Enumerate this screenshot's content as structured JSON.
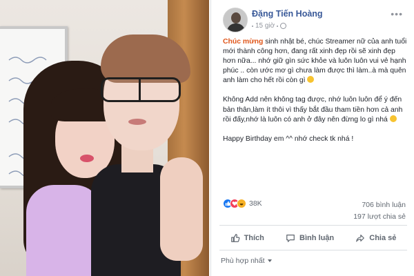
{
  "post": {
    "author": "Đặng Tiến Hoàng",
    "time": "15 giờ",
    "paragraph1_highlight": "Chúc mừng",
    "paragraph1_rest": " sinh nhật bé, chúc Streamer nữ của anh tuổi mới thành công hơn, đang rất xinh đẹp rồi sẽ xinh đẹp hơn nữa... nhớ giữ gìn sức khỏe và luôn luôn vui vẻ hạnh phúc .. còn ước mơ gì chưa làm được thì làm..à mà quên anh làm cho hết rồi còn gì",
    "paragraph2": "Không Add nên không tag được, nhớ luôn luôn để ý đến bản thân,làm ít thôi vì thấy bắt đầu tham tiền hơn cả anh rồi đấy,nhớ là luôn có anh ở đây nên đừng lo gì nhá",
    "paragraph3": "Happy Birthday em ^^ nhớ check tk nhá !",
    "reaction_count": "38K",
    "comments": "706 bình luận",
    "shares": "197 lượt chia sẻ",
    "actions": {
      "like": "Thích",
      "comment": "Bình luận",
      "share": "Chia sẻ"
    },
    "sort_label": "Phù hợp nhất"
  },
  "colors": {
    "author_link": "#385898",
    "highlight": "#e0561a",
    "like_blue": "#1877f2",
    "love_red": "#f33e58",
    "haha_yellow": "#f7b125"
  }
}
